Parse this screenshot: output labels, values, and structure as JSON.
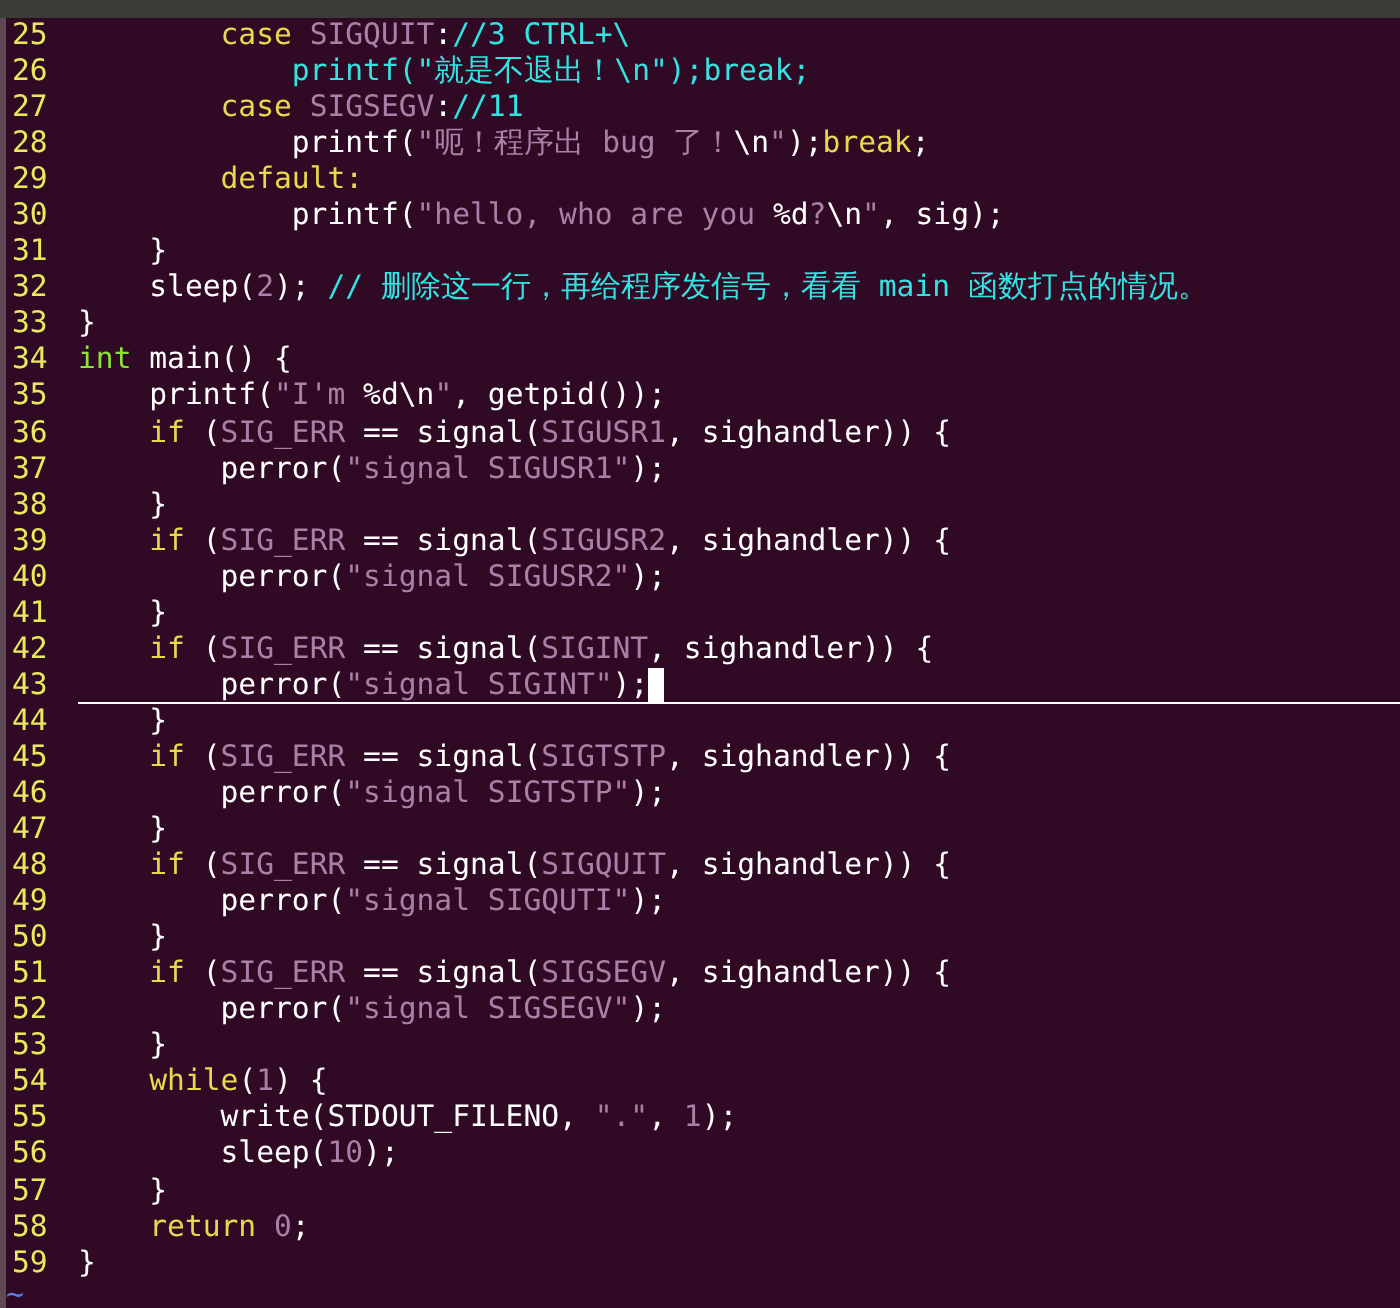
{
  "menu_bar": {
    "kind": "strip"
  },
  "lines": [
    {
      "number": "25",
      "tokens": [
        {
          "kind": "k",
          "text": "        case "
        },
        {
          "kind": "c",
          "text": "SIGQUIT"
        },
        {
          "kind": "p",
          "text": ":"
        },
        {
          "kind": "m",
          "text": "//3 CTRL+\\"
        }
      ]
    },
    {
      "number": "26",
      "tokens": [
        {
          "kind": "m",
          "text": "            printf(\"就是不退出！\\n\");break;"
        }
      ]
    },
    {
      "number": "27",
      "tokens": [
        {
          "kind": "k",
          "text": "        case "
        },
        {
          "kind": "c",
          "text": "SIGSEGV"
        },
        {
          "kind": "p",
          "text": ":"
        },
        {
          "kind": "m",
          "text": "//11"
        }
      ]
    },
    {
      "number": "28",
      "tokens": [
        {
          "kind": "p",
          "text": "            printf("
        },
        {
          "kind": "c",
          "text": "\"呃！程序出 bug 了！"
        },
        {
          "kind": "p",
          "text": "\\n"
        },
        {
          "kind": "c",
          "text": "\""
        },
        {
          "kind": "p",
          "text": ");"
        },
        {
          "kind": "k",
          "text": "break"
        },
        {
          "kind": "p",
          "text": ";"
        }
      ]
    },
    {
      "number": "29",
      "tokens": [
        {
          "kind": "k",
          "text": "        default:"
        }
      ]
    },
    {
      "number": "30",
      "tokens": [
        {
          "kind": "p",
          "text": "            printf("
        },
        {
          "kind": "c",
          "text": "\"hello, who are you "
        },
        {
          "kind": "p",
          "text": "%d"
        },
        {
          "kind": "c",
          "text": "?"
        },
        {
          "kind": "p",
          "text": "\\n"
        },
        {
          "kind": "c",
          "text": "\""
        },
        {
          "kind": "p",
          "text": ", sig);"
        }
      ]
    },
    {
      "number": "31",
      "tokens": [
        {
          "kind": "p",
          "text": "    }"
        }
      ]
    },
    {
      "number": "32",
      "tokens": [
        {
          "kind": "p",
          "text": "    sleep("
        },
        {
          "kind": "c",
          "text": "2"
        },
        {
          "kind": "p",
          "text": "); "
        },
        {
          "kind": "m",
          "text": "// 删除这一行，再给程序发信号，看看 main 函数打点的情况。"
        }
      ]
    },
    {
      "number": "33",
      "tokens": [
        {
          "kind": "p",
          "text": "}"
        }
      ]
    },
    {
      "number": "34",
      "tokens": [
        {
          "kind": "t",
          "text": "int"
        },
        {
          "kind": "p",
          "text": " main() {"
        }
      ]
    },
    {
      "number": "35",
      "tokens": [
        {
          "kind": "p",
          "text": "    printf("
        },
        {
          "kind": "c",
          "text": "\"I'm "
        },
        {
          "kind": "p",
          "text": "%d\\n"
        },
        {
          "kind": "c",
          "text": "\""
        },
        {
          "kind": "p",
          "text": ", getpid());"
        }
      ]
    },
    {
      "number": "36",
      "tokens": [
        {
          "kind": "k",
          "text": "    if"
        },
        {
          "kind": "p",
          "text": " ("
        },
        {
          "kind": "c",
          "text": "SIG_ERR"
        },
        {
          "kind": "p",
          "text": " == signal("
        },
        {
          "kind": "c",
          "text": "SIGUSR1"
        },
        {
          "kind": "p",
          "text": ", sighandler)) {"
        }
      ]
    },
    {
      "number": "37",
      "tokens": [
        {
          "kind": "p",
          "text": "        perror("
        },
        {
          "kind": "c",
          "text": "\"signal SIGUSR1\""
        },
        {
          "kind": "p",
          "text": ");"
        }
      ]
    },
    {
      "number": "38",
      "tokens": [
        {
          "kind": "p",
          "text": "    }"
        }
      ]
    },
    {
      "number": "39",
      "tokens": [
        {
          "kind": "k",
          "text": "    if"
        },
        {
          "kind": "p",
          "text": " ("
        },
        {
          "kind": "c",
          "text": "SIG_ERR"
        },
        {
          "kind": "p",
          "text": " == signal("
        },
        {
          "kind": "c",
          "text": "SIGUSR2"
        },
        {
          "kind": "p",
          "text": ", sighandler)) {"
        }
      ]
    },
    {
      "number": "40",
      "tokens": [
        {
          "kind": "p",
          "text": "        perror("
        },
        {
          "kind": "c",
          "text": "\"signal SIGUSR2\""
        },
        {
          "kind": "p",
          "text": ");"
        }
      ]
    },
    {
      "number": "41",
      "tokens": [
        {
          "kind": "p",
          "text": "    }"
        }
      ]
    },
    {
      "number": "42",
      "tokens": [
        {
          "kind": "k",
          "text": "    if"
        },
        {
          "kind": "p",
          "text": " ("
        },
        {
          "kind": "c",
          "text": "SIG_ERR"
        },
        {
          "kind": "p",
          "text": " == signal("
        },
        {
          "kind": "c",
          "text": "SIGINT"
        },
        {
          "kind": "p",
          "text": ", sighandler)) {"
        }
      ]
    },
    {
      "number": "43",
      "current": true,
      "cursor": true,
      "tokens": [
        {
          "kind": "p",
          "text": "        perror("
        },
        {
          "kind": "c",
          "text": "\"signal SIGINT\""
        },
        {
          "kind": "p",
          "text": ");"
        }
      ]
    },
    {
      "number": "44",
      "tokens": [
        {
          "kind": "p",
          "text": "    }"
        }
      ]
    },
    {
      "number": "45",
      "tokens": [
        {
          "kind": "k",
          "text": "    if"
        },
        {
          "kind": "p",
          "text": " ("
        },
        {
          "kind": "c",
          "text": "SIG_ERR"
        },
        {
          "kind": "p",
          "text": " == signal("
        },
        {
          "kind": "c",
          "text": "SIGTSTP"
        },
        {
          "kind": "p",
          "text": ", sighandler)) {"
        }
      ]
    },
    {
      "number": "46",
      "tokens": [
        {
          "kind": "p",
          "text": "        perror("
        },
        {
          "kind": "c",
          "text": "\"signal SIGTSTP\""
        },
        {
          "kind": "p",
          "text": ");"
        }
      ]
    },
    {
      "number": "47",
      "tokens": [
        {
          "kind": "p",
          "text": "    }"
        }
      ]
    },
    {
      "number": "48",
      "tokens": [
        {
          "kind": "k",
          "text": "    if"
        },
        {
          "kind": "p",
          "text": " ("
        },
        {
          "kind": "c",
          "text": "SIG_ERR"
        },
        {
          "kind": "p",
          "text": " == signal("
        },
        {
          "kind": "c",
          "text": "SIGQUIT"
        },
        {
          "kind": "p",
          "text": ", sighandler)) {"
        }
      ]
    },
    {
      "number": "49",
      "tokens": [
        {
          "kind": "p",
          "text": "        perror("
        },
        {
          "kind": "c",
          "text": "\"signal SIGQUTI\""
        },
        {
          "kind": "p",
          "text": ");"
        }
      ]
    },
    {
      "number": "50",
      "tokens": [
        {
          "kind": "p",
          "text": "    }"
        }
      ]
    },
    {
      "number": "51",
      "tokens": [
        {
          "kind": "k",
          "text": "    if"
        },
        {
          "kind": "p",
          "text": " ("
        },
        {
          "kind": "c",
          "text": "SIG_ERR"
        },
        {
          "kind": "p",
          "text": " == signal("
        },
        {
          "kind": "c",
          "text": "SIGSEGV"
        },
        {
          "kind": "p",
          "text": ", sighandler)) {"
        }
      ]
    },
    {
      "number": "52",
      "tokens": [
        {
          "kind": "p",
          "text": "        perror("
        },
        {
          "kind": "c",
          "text": "\"signal SIGSEGV\""
        },
        {
          "kind": "p",
          "text": ");"
        }
      ]
    },
    {
      "number": "53",
      "tokens": [
        {
          "kind": "p",
          "text": "    }"
        }
      ]
    },
    {
      "number": "54",
      "tokens": [
        {
          "kind": "k",
          "text": "    while"
        },
        {
          "kind": "p",
          "text": "("
        },
        {
          "kind": "c",
          "text": "1"
        },
        {
          "kind": "p",
          "text": ") {"
        }
      ]
    },
    {
      "number": "55",
      "tokens": [
        {
          "kind": "p",
          "text": "        write(STDOUT_FILENO, "
        },
        {
          "kind": "c",
          "text": "\".\""
        },
        {
          "kind": "p",
          "text": ", "
        },
        {
          "kind": "c",
          "text": "1"
        },
        {
          "kind": "p",
          "text": ");"
        }
      ]
    },
    {
      "number": "56",
      "tokens": [
        {
          "kind": "p",
          "text": "        sleep("
        },
        {
          "kind": "c",
          "text": "10"
        },
        {
          "kind": "p",
          "text": ");"
        }
      ]
    },
    {
      "number": "57",
      "tokens": [
        {
          "kind": "p",
          "text": "    }"
        }
      ]
    },
    {
      "number": "58",
      "tokens": [
        {
          "kind": "k",
          "text": "    return "
        },
        {
          "kind": "c",
          "text": "0"
        },
        {
          "kind": "p",
          "text": ";"
        }
      ]
    },
    {
      "number": "59",
      "tokens": [
        {
          "kind": "p",
          "text": "}"
        }
      ]
    }
  ],
  "filler": "~"
}
